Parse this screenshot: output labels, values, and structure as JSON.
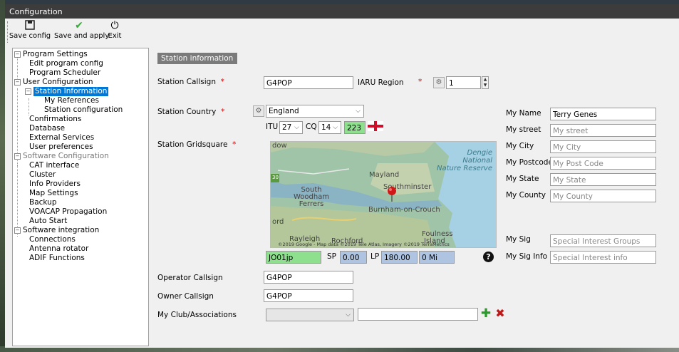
{
  "window": {
    "title": "Configuration"
  },
  "toolbar": {
    "save_config": "Save config",
    "save_apply": "Save and apply",
    "exit": "Exit"
  },
  "tree": {
    "program_settings": "Program Settings",
    "edit_program_config": "Edit program config",
    "program_scheduler": "Program Scheduler",
    "user_configuration": "User Configuration",
    "station_information": "Station Information",
    "my_references": "My References",
    "station_configuration": "Station configuration",
    "confirmations": "Confirmations",
    "database": "Database",
    "external_services": "External Services",
    "user_preferences": "User preferences",
    "software_configuration": "Software Configuration",
    "cat_interface": "CAT interface",
    "cluster": "Cluster",
    "info_providers": "Info Providers",
    "map_settings": "Map Settings",
    "backup": "Backup",
    "voacap_propagation": "VOACAP Propagation",
    "auto_start": "Auto Start",
    "software_integration": "Software integration",
    "connections": "Connections",
    "antenna_rotator": "Antenna rotator",
    "adif_functions": "ADIF Functions"
  },
  "form": {
    "section_title": "Station information",
    "required_mark": "*",
    "station_callsign_label": "Station Callsign",
    "station_callsign_value": "G4POP",
    "iaru_region_label": "IARU Region",
    "iaru_region_value": "1",
    "station_country_label": "Station Country",
    "station_country_value": "England",
    "itu_label": "ITU",
    "itu_value": "27",
    "cq_label": "CQ",
    "cq_value": "14",
    "dxcc_value": "223",
    "station_gridsquare_label": "Station Gridsquare",
    "gridsquare_value": "JO01jp",
    "sp_label": "SP",
    "sp_value": "0.00",
    "lp_label": "LP",
    "lp_value": "180.00",
    "distance_value": "0 Mi",
    "operator_callsign_label": "Operator Callsign",
    "operator_callsign_value": "G4POP",
    "owner_callsign_label": "Owner Callsign",
    "owner_callsign_value": "G4POP",
    "club_label": "My Club/Associations",
    "club_select_value": "",
    "club_text_value": ""
  },
  "map": {
    "places": {
      "top_label": "dow",
      "dengie": "Dengie\nNational\nNature Reserve",
      "mayland": "Mayland",
      "southminster": "Southminster",
      "south_woodham": "South\nWoodham\nFerrers",
      "burnham": "Burnham-on-Crouch",
      "foulness": "Foulness",
      "ord": "ord",
      "rayleigh": "Rayleigh",
      "rochford": "Rochford",
      "island": "Island",
      "road_number": "30"
    },
    "copyright": "©2019 Google - Map data ©2019 Tele Atlas, Imagery ©2019 TerraMetrics"
  },
  "personal": {
    "my_name_label": "My Name",
    "my_name_value": "Terry Genes",
    "my_street_label": "My street",
    "my_street_placeholder": "My street",
    "my_city_label": "My City",
    "my_city_placeholder": "My City",
    "my_postcode_label": "My Postcode",
    "my_postcode_placeholder": "My Post Code",
    "my_state_label": "My State",
    "my_state_placeholder": "My State",
    "my_county_label": "My County",
    "my_county_placeholder": "My County",
    "my_sig_label": "My Sig",
    "my_sig_placeholder": "Special Interest Groups",
    "my_sig_info_label": "My Sig Info",
    "my_sig_info_placeholder": "Special Interest info"
  },
  "icons": {
    "save": "floppy-icon",
    "apply": "checkmark-icon",
    "exit": "power-icon",
    "help": "help-icon",
    "add": "plus-icon",
    "remove": "x-icon"
  }
}
